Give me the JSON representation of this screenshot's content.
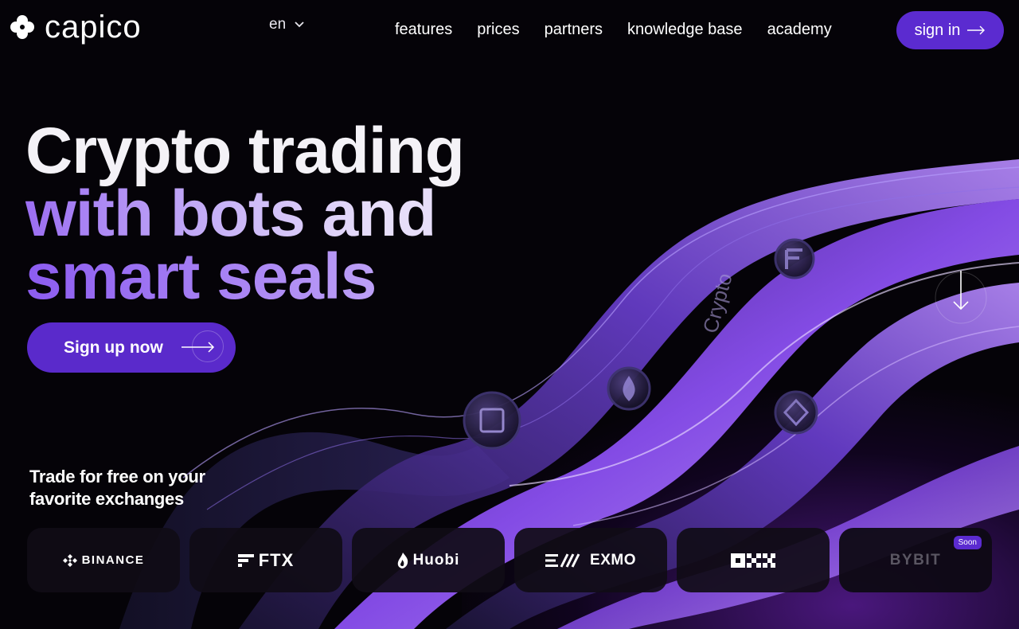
{
  "brand": {
    "name": "capico"
  },
  "header": {
    "language": "en",
    "nav": [
      "features",
      "prices",
      "partners",
      "knowledge base",
      "academy"
    ],
    "signin_label": "sign in"
  },
  "hero": {
    "title_line1": "Crypto trading",
    "title_line2": "with bots and",
    "title_line3": "smart seals",
    "cta_label": "Sign up now",
    "art_text": "Crypto"
  },
  "exchanges_section": {
    "heading_line1": "Trade for free on your",
    "heading_line2": "favorite exchanges",
    "items": [
      {
        "name": "BINANCE",
        "icon": "binance-icon"
      },
      {
        "name": "FTX",
        "icon": "ftx-icon"
      },
      {
        "name": "Huobi",
        "icon": "huobi-icon"
      },
      {
        "name": "EXMO",
        "icon": "exmo-icon"
      },
      {
        "name": "OKX",
        "icon": "okx-icon"
      },
      {
        "name": "BYBIT",
        "icon": "bybit-icon",
        "badge": "Soon"
      }
    ]
  },
  "colors": {
    "accent": "#5b2bd0",
    "background": "#050308",
    "text": "#ffffff",
    "gradient_light": "#e7def9",
    "gradient_mid": "#9b6ef2"
  }
}
